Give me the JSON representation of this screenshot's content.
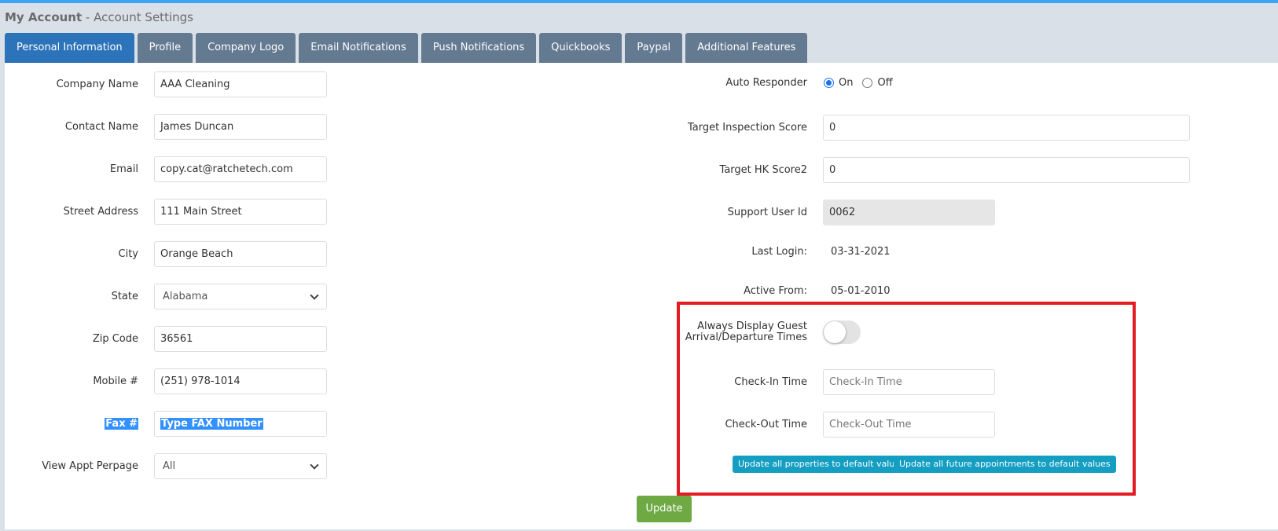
{
  "header": {
    "title_bold": "My Account",
    "title_rest": " - Account Settings"
  },
  "tabs": [
    {
      "label": "Personal Information",
      "active": true
    },
    {
      "label": "Profile",
      "active": false
    },
    {
      "label": "Company Logo",
      "active": false
    },
    {
      "label": "Email Notifications",
      "active": false
    },
    {
      "label": "Push Notifications",
      "active": false
    },
    {
      "label": "Quickbooks",
      "active": false
    },
    {
      "label": "Paypal",
      "active": false
    },
    {
      "label": "Additional Features",
      "active": false
    }
  ],
  "left_form": {
    "company_name": {
      "label": "Company Name",
      "value": "AAA  Cleaning"
    },
    "contact_name": {
      "label": "Contact Name",
      "value": "James Duncan"
    },
    "email": {
      "label": "Email",
      "value": "copy.cat@ratchetech.com"
    },
    "street_address": {
      "label": "Street Address",
      "value": "111 Main Street"
    },
    "city": {
      "label": "City",
      "value": "Orange Beach"
    },
    "state": {
      "label": "State",
      "value": "Alabama"
    },
    "zip_code": {
      "label": "Zip Code",
      "value": "36561"
    },
    "mobile": {
      "label": "Mobile #",
      "value": "(251) 978-1014"
    },
    "fax": {
      "label": "Fax #",
      "placeholder": "Type FAX Number"
    },
    "view_appt_perpage": {
      "label": "View Appt Perpage",
      "value": "All"
    }
  },
  "right_form": {
    "auto_responder": {
      "label": "Auto Responder",
      "options": [
        "On",
        "Off"
      ],
      "selected": "On"
    },
    "target_inspection_score": {
      "label": "Target Inspection Score",
      "value": "0"
    },
    "target_hk_score2": {
      "label": "Target HK Score2",
      "value": "0"
    },
    "support_user_id": {
      "label": "Support User Id",
      "value": "0062"
    },
    "last_login": {
      "label": "Last Login:",
      "value": "03-31-2021"
    },
    "active_from": {
      "label": "Active From:",
      "value": "05-01-2010"
    },
    "always_display_guest": {
      "label_line1": "Always Display Guest",
      "label_line2": "Arrival/Departure Times",
      "enabled": false
    },
    "check_in_time": {
      "label": "Check-In Time",
      "placeholder": "Check-In Time"
    },
    "check_out_time": {
      "label": "Check-Out Time",
      "placeholder": "Check-Out Time"
    },
    "update_properties_button": "Update all properties to default values",
    "update_appointments_button": "Update all future appointments to default values"
  },
  "update_button": "Update",
  "colors": {
    "top_accent": "#3da5f5",
    "tab_active": "#2c73b9",
    "tab_inactive": "#637a91",
    "highlight_box": "#e31b23",
    "info_button": "#139ec2",
    "success_button": "#6ea944"
  }
}
